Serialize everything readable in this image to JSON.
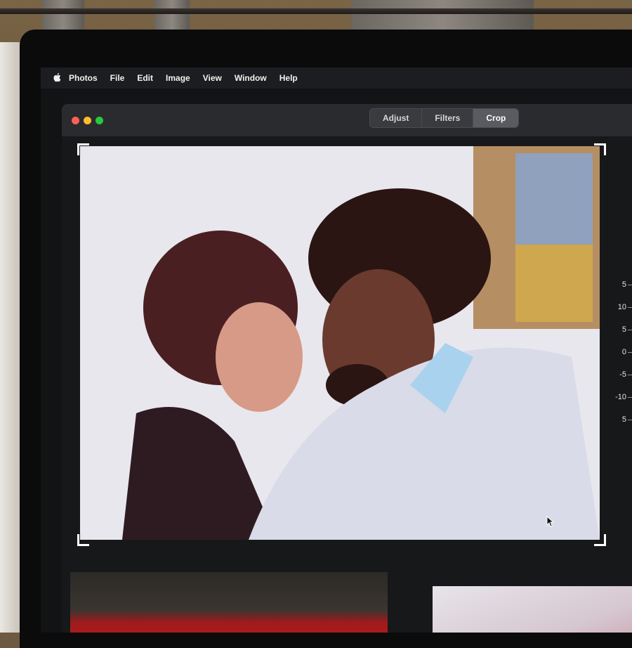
{
  "menubar": {
    "app_name": "Photos",
    "items": [
      "File",
      "Edit",
      "Image",
      "View",
      "Window",
      "Help"
    ]
  },
  "toolbar": {
    "tabs": [
      {
        "label": "Adjust",
        "active": false
      },
      {
        "label": "Filters",
        "active": false
      },
      {
        "label": "Crop",
        "active": true
      }
    ]
  },
  "straighten_dial": {
    "labels": [
      "5",
      "10",
      "5",
      "0",
      "-5",
      "-10",
      "5"
    ],
    "current_value": "0"
  },
  "colors": {
    "accent": "#3ea0ff",
    "close": "#ff5f57",
    "minimize": "#febc2e",
    "maximize": "#28c840"
  },
  "icons": [
    "apple-icon",
    "pointer-cursor-icon"
  ]
}
